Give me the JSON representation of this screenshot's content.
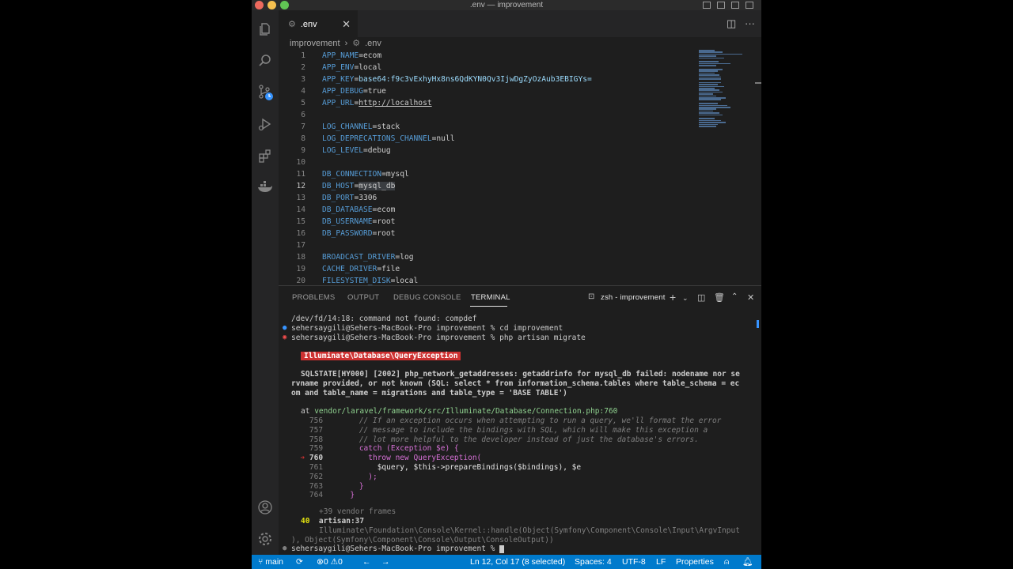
{
  "window": {
    "title": ".env — improvement"
  },
  "editor": {
    "tab_label": ".env",
    "breadcrumb": {
      "folder": "improvement",
      "file": ".env"
    },
    "lines": [
      {
        "n": "1",
        "key": "APP_NAME",
        "val": "ecom"
      },
      {
        "n": "2",
        "key": "APP_ENV",
        "val": "local"
      },
      {
        "n": "3",
        "key": "APP_KEY",
        "val": "base64:f9c3vExhyHx8ns6QdKYN0Qv3IjwDgZyOzAub3EBIGYs="
      },
      {
        "n": "4",
        "key": "APP_DEBUG",
        "val": "true"
      },
      {
        "n": "5",
        "key": "APP_URL",
        "val": "http://localhost"
      },
      {
        "n": "6",
        "key": "",
        "val": ""
      },
      {
        "n": "7",
        "key": "LOG_CHANNEL",
        "val": "stack"
      },
      {
        "n": "8",
        "key": "LOG_DEPRECATIONS_CHANNEL",
        "val": "null"
      },
      {
        "n": "9",
        "key": "LOG_LEVEL",
        "val": "debug"
      },
      {
        "n": "10",
        "key": "",
        "val": ""
      },
      {
        "n": "11",
        "key": "DB_CONNECTION",
        "val": "mysql"
      },
      {
        "n": "12",
        "key": "DB_HOST",
        "val": "mysql_db"
      },
      {
        "n": "13",
        "key": "DB_PORT",
        "val": "3306"
      },
      {
        "n": "14",
        "key": "DB_DATABASE",
        "val": "ecom"
      },
      {
        "n": "15",
        "key": "DB_USERNAME",
        "val": "root"
      },
      {
        "n": "16",
        "key": "DB_PASSWORD",
        "val": "root"
      },
      {
        "n": "17",
        "key": "",
        "val": ""
      },
      {
        "n": "18",
        "key": "BROADCAST_DRIVER",
        "val": "log"
      },
      {
        "n": "19",
        "key": "CACHE_DRIVER",
        "val": "file"
      },
      {
        "n": "20",
        "key": "FILESYSTEM_DISK",
        "val": "local"
      }
    ]
  },
  "panel": {
    "tabs": [
      "PROBLEMS",
      "OUTPUT",
      "DEBUG CONSOLE",
      "TERMINAL"
    ],
    "active_tab": "TERMINAL",
    "terminal_name": "zsh - improvement"
  },
  "terminal": {
    "l1": "/dev/fd/14:18: command not found: compdef",
    "l2": "sehersaygili@Sehers-MacBook-Pro improvement % cd improvement",
    "l3": "sehersaygili@Sehers-MacBook-Pro improvement % php artisan migrate",
    "exception": "Illuminate\\Database\\QueryException",
    "err1": "SQLSTATE[HY000] [2002] php_network_getaddresses: getaddrinfo for mysql_db failed: nodename nor se",
    "err2": "rvname provided, or not known (SQL: select * from information_schema.tables where table_schema = ec",
    "err3": "om and table_name = migrations and table_type = 'BASE TABLE')",
    "at_label": "at",
    "at_path": "vendor/laravel/framework/src/Illuminate/Database/Connection.php:760",
    "src": [
      {
        "n": "756",
        "code": "// If an exception occurs when attempting to run a query, we'll format the error"
      },
      {
        "n": "757",
        "code": "// message to include the bindings with SQL, which will make this exception a"
      },
      {
        "n": "758",
        "code": "// lot more helpful to the developer instead of just the database's errors."
      },
      {
        "n": "759",
        "code": "catch (Exception $e) {"
      },
      {
        "n": "760",
        "code": "throw new QueryException("
      },
      {
        "n": "761",
        "code": "$query, $this->prepareBindings($bindings), $e"
      },
      {
        "n": "762",
        "code": ");"
      },
      {
        "n": "763",
        "code": "}"
      },
      {
        "n": "764",
        "code": "}"
      }
    ],
    "vendor_frames": "+39 vendor frames",
    "frame_no": "40",
    "frame_file": "artisan:37",
    "frame_l1": "Illuminate\\Foundation\\Console\\Kernel::handle(Object(Symfony\\Component\\Console\\Input\\ArgvInput",
    "frame_l2": "), Object(Symfony\\Component\\Console\\Output\\ConsoleOutput))",
    "prompt": "sehersaygili@Sehers-MacBook-Pro improvement % "
  },
  "status": {
    "branch": "main",
    "errors": "0",
    "warnings": "0",
    "position": "Ln 12, Col 17 (8 selected)",
    "spaces": "Spaces: 4",
    "encoding": "UTF-8",
    "eol": "LF",
    "language": "Properties"
  }
}
